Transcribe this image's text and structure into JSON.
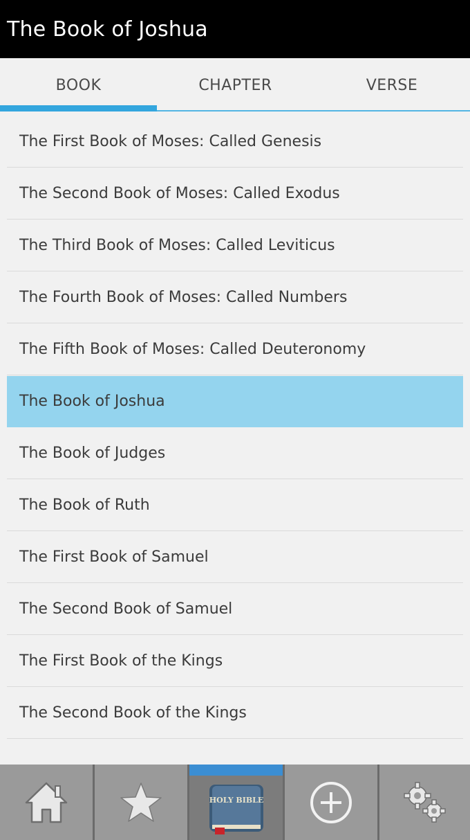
{
  "header": {
    "title": "The Book of Joshua"
  },
  "tabs": [
    {
      "label": "BOOK",
      "selected": true
    },
    {
      "label": "CHAPTER",
      "selected": false
    },
    {
      "label": "VERSE",
      "selected": false
    }
  ],
  "books": [
    {
      "label": "The First Book of Moses: Called Genesis"
    },
    {
      "label": "The Second Book of Moses: Called Exodus"
    },
    {
      "label": "The Third Book of Moses: Called Leviticus"
    },
    {
      "label": "The Fourth Book of Moses: Called Numbers"
    },
    {
      "label": "The Fifth Book of Moses: Called Deuteronomy"
    },
    {
      "label": "The Book of Joshua",
      "selected": true
    },
    {
      "label": "The Book of Judges"
    },
    {
      "label": "The Book of Ruth"
    },
    {
      "label": "The First Book of Samuel"
    },
    {
      "label": "The Second Book of Samuel"
    },
    {
      "label": "The First Book of the Kings"
    },
    {
      "label": "The Second Book of the Kings"
    }
  ],
  "bottom_nav": [
    {
      "icon": "home-icon"
    },
    {
      "icon": "star-icon"
    },
    {
      "icon": "bible-book-icon",
      "active": true,
      "logo_text": "HOLY BIBLE"
    },
    {
      "icon": "plus-circle-icon"
    },
    {
      "icon": "gears-icon"
    }
  ],
  "colors": {
    "titlebar_bg": "#000000",
    "tab_indicator": "#33a6de",
    "selected_item_bg": "#94d4ee",
    "bottom_bar_bg": "#9a9a9a",
    "active_nav_highlight": "#3b8ed3"
  }
}
